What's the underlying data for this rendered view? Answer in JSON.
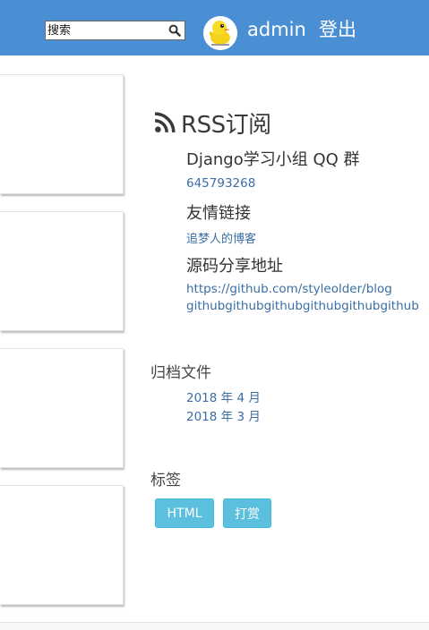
{
  "header": {
    "search_placeholder": "搜索",
    "search_icon": "search-icon",
    "avatar_icon": "yellow-duck-avatar",
    "username": "admin",
    "logout": "登出"
  },
  "sidebar": {
    "rss_icon": "rss-icon",
    "rss_title": "RSS订阅",
    "qq_group_title": "Django学习小组 QQ 群",
    "qq_group_number": "645793268",
    "friend_links_title": "友情链接",
    "friend_link": "追梦人的博客",
    "source_title": "源码分享地址",
    "source_link_1": "https://github.com/styleolder/blog",
    "source_link_2": "githubgithubgithubgithubgithubgithub",
    "archive_title": "归档文件",
    "archives": [
      "2018 年 4 月",
      "2018 年 3 月"
    ],
    "tags_title": "标签",
    "tags": [
      "HTML",
      "打赏"
    ]
  },
  "colors": {
    "header_bg": "#4a8fd4",
    "link": "#3a6ea5",
    "tag_bg": "#5bc0de"
  }
}
